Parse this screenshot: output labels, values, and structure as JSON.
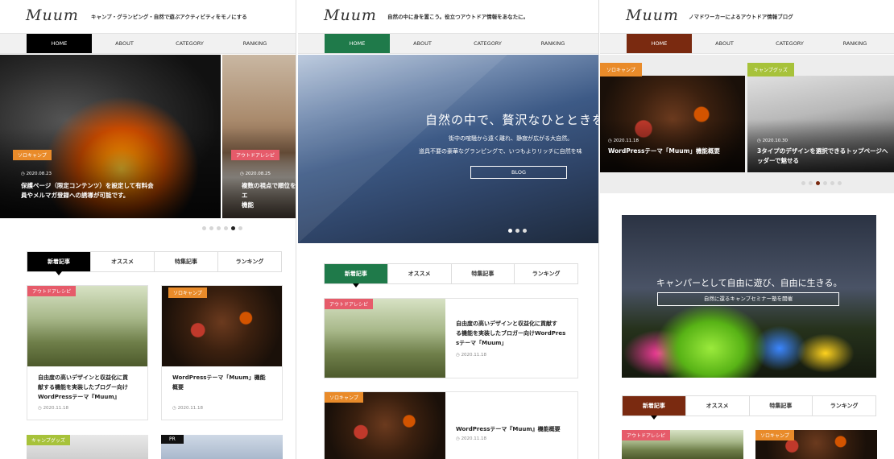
{
  "panels": [
    {
      "logo": "Muum",
      "tagline": "キャンプ・グランピング・自然で遊ぶアクティビティをモノにする",
      "accent": "#000000",
      "nav": [
        "HOME",
        "ABOUT",
        "CATEGORY",
        "RANKING"
      ],
      "slides": [
        {
          "category": "ソロキャンプ",
          "date": "2020.08.23",
          "title_line1": "保護ページ（限定コンテンツ）を設定して有料会",
          "title_line2": "員やメルマガ登録への誘導が可能です。"
        },
        {
          "category": "アウトドアレシピ",
          "date": "2020.08.25",
          "title_line1": "複数の視点で順位をエ",
          "title_line2": "機能"
        }
      ],
      "dot_count": 6,
      "active_dot": 4,
      "tabs": [
        "新着記事",
        "オススメ",
        "特集記事",
        "ランキング"
      ],
      "cards": [
        {
          "category": "アウトドアレシピ",
          "title_line1": "自由度の高いデザインと収益化に貢",
          "title_line2": "献する機能を実装したブログー向け",
          "title_line3": "WordPressテーマ『Muum』",
          "date": "2020.11.18"
        },
        {
          "category": "ソロキャンプ",
          "title_line1": "WordPressテーマ「Muum」機能",
          "title_line2": "概要",
          "title_line3": "",
          "date": "2020.11.18"
        }
      ],
      "bottom_badges": [
        "キャンプグッズ",
        "PR"
      ]
    },
    {
      "logo": "Muum",
      "tagline": "自然の中に身を置こう。役立つアウトドア情報をあなたに。",
      "accent": "#1f7a4a",
      "nav": [
        "HOME",
        "ABOUT",
        "CATEGORY",
        "RANKING"
      ],
      "hero_heading": "自然の中で、贅沢なひとときを",
      "hero_sub1": "街中の喧騒から遠く離れ、静寂が広がる大自然。",
      "hero_sub2": "道具不要の豪華なグランピングで、いつもよりリッチに自然を味",
      "hero_button": "BLOG",
      "dot_count": 3,
      "active_dot": 0,
      "tabs": [
        "新着記事",
        "オススメ",
        "特集記事",
        "ランキング"
      ],
      "cards": [
        {
          "category": "アウトドアレシピ",
          "title_line1": "自由度の高いデザインと収益化に貢献す",
          "title_line2": "る機能を実装したブロガー向けWordPres",
          "title_line3": "sテーマ「Muum」",
          "date": "2020.11.18"
        },
        {
          "category": "ソロキャンプ",
          "title_line1": "WordPressテーマ『Muum』機能概要",
          "title_line2": "",
          "title_line3": "",
          "date": "2020.11.18"
        }
      ]
    },
    {
      "logo": "Muum",
      "tagline": "ノマドワーカーによるアウトドア情報ブログ",
      "accent": "#7a2a10",
      "nav": [
        "HOME",
        "ABOUT",
        "CATEGORY",
        "RANKING"
      ],
      "slides": [
        {
          "category": "ソロキャンプ",
          "date": "2020.11.18",
          "title_line1": "WordPressテーマ「Muum」機能概要",
          "title_line2": ""
        },
        {
          "category": "キャンプグッズ",
          "date": "2020.10.30",
          "title_line1": "3タイプのデザインを選択できるトップページへ",
          "title_line2": "ッダーで魅せる"
        }
      ],
      "dot_count": 6,
      "active_dot": 2,
      "banner_heading": "キャンパーとして自由に遊び、自由に生きる。",
      "banner_button": "自然に還るキャンプセミナー塾を開催",
      "tabs": [
        "新着記事",
        "オススメ",
        "特集記事",
        "ランキング"
      ],
      "bottom_badges": [
        "アウトドアレシピ",
        "ソロキャンプ"
      ]
    }
  ]
}
